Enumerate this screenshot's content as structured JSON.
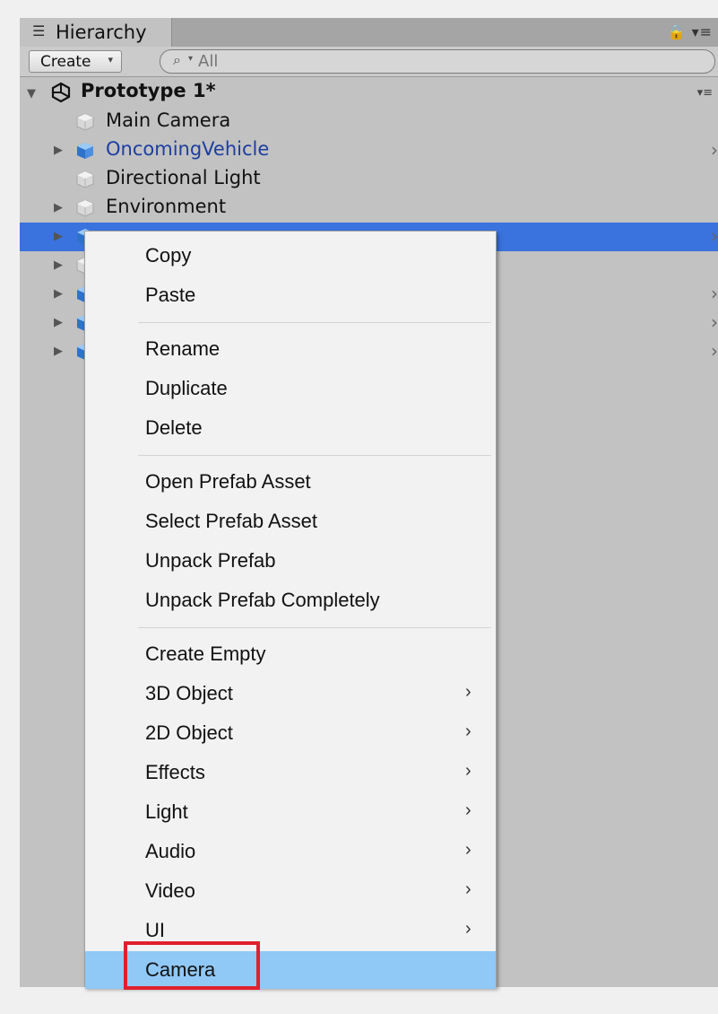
{
  "window": {
    "tab_label": "Hierarchy",
    "tab_icon": "list-icon",
    "lock_icon": "🔒",
    "tab_menu_icon": "▾≡"
  },
  "toolbar": {
    "create_label": "Create",
    "create_caret": "▾",
    "search_icon": "🔍",
    "search_caret": "▾",
    "search_placeholder": "All"
  },
  "scene": {
    "title": "Prototype 1*",
    "menu_icon": "▾≡"
  },
  "hierarchy": {
    "items": [
      {
        "name": "Main Camera",
        "expandable": false,
        "prefab": false,
        "selected": false,
        "has_submenu": false
      },
      {
        "name": "OncomingVehicle",
        "expandable": true,
        "prefab": true,
        "selected": false,
        "has_submenu": true
      },
      {
        "name": "Directional Light",
        "expandable": false,
        "prefab": false,
        "selected": false,
        "has_submenu": false
      },
      {
        "name": "Environment",
        "expandable": true,
        "prefab": false,
        "selected": false,
        "has_submenu": false
      },
      {
        "name": "",
        "expandable": true,
        "prefab": true,
        "selected": true,
        "has_submenu": true
      },
      {
        "name": "",
        "expandable": true,
        "prefab": false,
        "selected": false,
        "has_submenu": false
      },
      {
        "name": "",
        "expandable": true,
        "prefab": true,
        "selected": false,
        "has_submenu": true
      },
      {
        "name": "",
        "expandable": true,
        "prefab": true,
        "selected": false,
        "has_submenu": true
      },
      {
        "name": "",
        "expandable": true,
        "prefab": true,
        "selected": false,
        "has_submenu": true
      }
    ]
  },
  "context_menu": {
    "groups": [
      {
        "items": [
          {
            "label": "Copy"
          },
          {
            "label": "Paste"
          }
        ]
      },
      {
        "items": [
          {
            "label": "Rename"
          },
          {
            "label": "Duplicate"
          },
          {
            "label": "Delete"
          }
        ]
      },
      {
        "items": [
          {
            "label": "Open Prefab Asset"
          },
          {
            "label": "Select Prefab Asset"
          },
          {
            "label": "Unpack Prefab"
          },
          {
            "label": "Unpack Prefab Completely"
          }
        ]
      },
      {
        "items": [
          {
            "label": "Create Empty"
          },
          {
            "label": "3D Object",
            "submenu": true
          },
          {
            "label": "2D Object",
            "submenu": true
          },
          {
            "label": "Effects",
            "submenu": true
          },
          {
            "label": "Light",
            "submenu": true
          },
          {
            "label": "Audio",
            "submenu": true
          },
          {
            "label": "Video",
            "submenu": true
          },
          {
            "label": "UI",
            "submenu": true
          },
          {
            "label": "Camera",
            "highlighted": true
          }
        ]
      }
    ],
    "submenu_glyph": "›"
  },
  "colors": {
    "selection": "#3a72de",
    "menu_highlight": "#90c8f6",
    "annotation_box": "#e0202c",
    "prefab_name": "#1c3ea2"
  }
}
